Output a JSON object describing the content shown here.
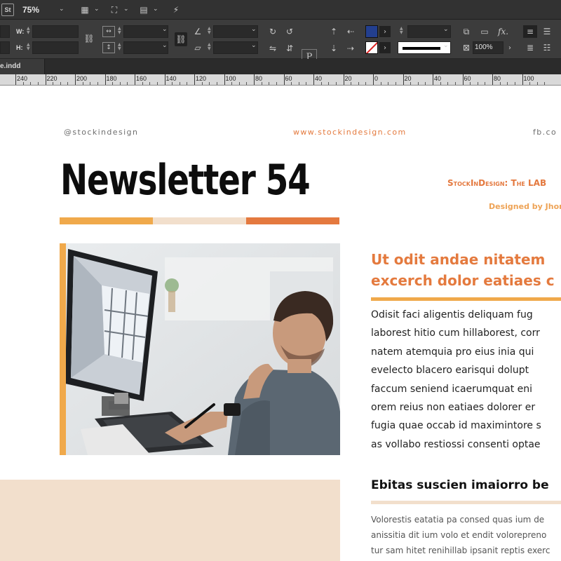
{
  "app": {
    "logo": "St",
    "zoom": "75%"
  },
  "control_panel": {
    "w_label": "W:",
    "h_label": "H:",
    "opacity": "100%",
    "fx_label": "fx."
  },
  "document_tab": {
    "name": "e.indd"
  },
  "ruler": {
    "labels": [
      "240",
      "220",
      "200",
      "180",
      "160",
      "140",
      "120",
      "100",
      "80",
      "60",
      "40",
      "20",
      "0",
      "20",
      "40",
      "60",
      "80",
      "100"
    ]
  },
  "page": {
    "handle": "@stockindesign",
    "website": "www.stockindesign.com",
    "fb": "fb.co",
    "title": "Newsletter 54",
    "lab_title": "StockInDesign: The LAB",
    "designed_by": "Designed by Jhon",
    "headline_lines": [
      "Ut odit andae nitatem",
      "excerch dolor eatiaes c"
    ],
    "body_lines": [
      "Odisit faci aligentis deliquam fug",
      "laborest hitio cum hillaborest, corr",
      "natem atemquia pro eius inia qui",
      "evelecto blacero earisqui dolupt",
      "faccum seniend icaerumquat eni",
      "orem reius non eatiaes dolorer er",
      "fugia quae occab id maximintore s",
      "as vollabo restiossi consenti optae"
    ],
    "subheading": "Ebitas suscien imaiorro be",
    "body2_lines": [
      "Volorestis eatatia pa consed quas ium de",
      "anissitia dit ium volo et endit volorepreno",
      "tur sam hitet renihillab ipsanit reptis exerc"
    ]
  },
  "colors": {
    "accent_orange": "#e47a3e",
    "accent_yellow": "#f0a94b",
    "beige": "#f2dfcc",
    "fill_swatch": "#233f8f",
    "chrome_dark": "#323232"
  }
}
